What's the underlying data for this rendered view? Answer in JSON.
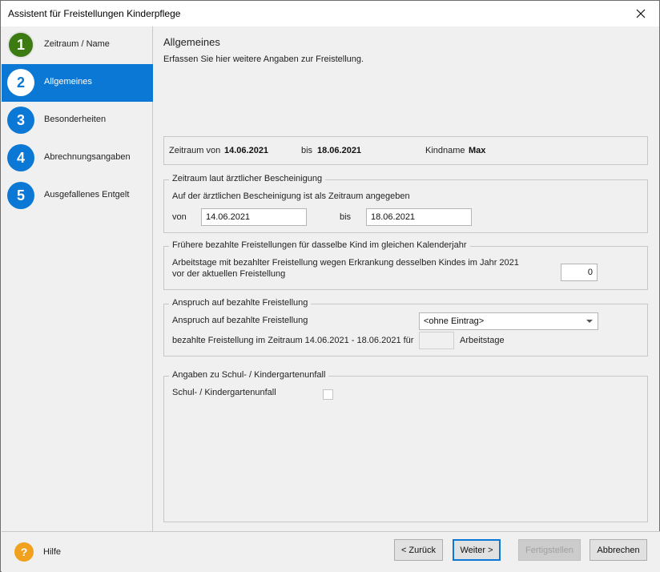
{
  "window": {
    "title": "Assistent für Freistellungen Kinderpflege"
  },
  "sidebar": {
    "steps": [
      {
        "number": "1",
        "label": "Zeitraum / Name"
      },
      {
        "number": "2",
        "label": "Allgemeines"
      },
      {
        "number": "3",
        "label": "Besonderheiten"
      },
      {
        "number": "4",
        "label": "Abrechnungsangaben"
      },
      {
        "number": "5",
        "label": "Ausgefallenes Entgelt"
      }
    ]
  },
  "page": {
    "title": "Allgemeines",
    "subtitle": "Erfassen Sie hier weitere Angaben zur Freistellung."
  },
  "summary": {
    "zeitraum_von_label": "Zeitraum von",
    "zeitraum_von": "14.06.2021",
    "bis_label": "bis",
    "bis": "18.06.2021",
    "kindname_label": "Kindname",
    "kindname": "Max"
  },
  "bescheinigung": {
    "legend": "Zeitraum laut ärztlicher Bescheinigung",
    "info": "Auf der ärztlichen Bescheinigung ist als Zeitraum angegeben",
    "von_label": "von",
    "von_value": "14.06.2021",
    "bis_label": "bis",
    "bis_value": "18.06.2021"
  },
  "fruehere": {
    "legend": "Frühere bezahlte Freistellungen für dasselbe Kind im gleichen Kalenderjahr",
    "line1": "Arbeitstage mit bezahlter Freistellung wegen Erkrankung desselben Kindes im Jahr 2021",
    "line2": "vor der aktuellen Freistellung",
    "value": "0"
  },
  "anspruch": {
    "legend": "Anspruch auf bezahlte Freistellung",
    "label": "Anspruch auf bezahlte Freistellung",
    "select_value": "<ohne Eintrag>",
    "zeitraum_label": "bezahlte Freistellung im Zeitraum 14.06.2021 - 18.06.2021 für",
    "zeitraum_value": "",
    "unit": "Arbeitstage"
  },
  "unfall": {
    "legend": "Angaben zu Schul- / Kindergartenunfall",
    "label": "Schul- / Kindergartenunfall",
    "checked": false
  },
  "footer": {
    "help_label": "Hilfe",
    "back_label": "< Zurück",
    "next_label": "Weiter >",
    "finish_label": "Fertigstellen",
    "cancel_label": "Abbrechen"
  },
  "colors": {
    "accent": "#0a78d4",
    "step_done": "#3c7a12",
    "help": "#f0a21e"
  }
}
